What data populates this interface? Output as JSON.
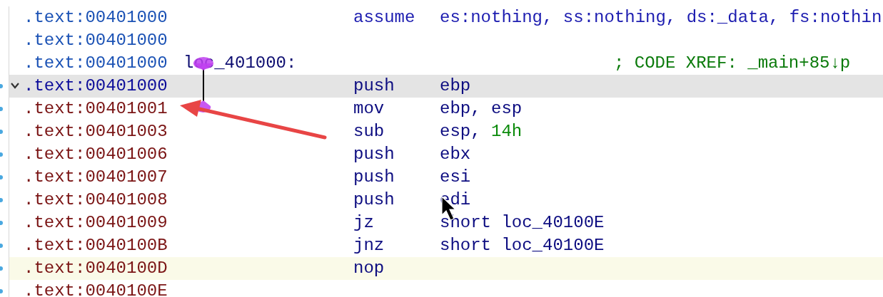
{
  "listing": {
    "rows": [
      {
        "kind": "directive",
        "address": ".text:00401000",
        "mnemonic": "assume",
        "operands": [
          {
            "kind": "plain",
            "text": "es:nothing, ss:nothing, ds:_data, fs:nothin"
          }
        ],
        "selected": false,
        "highlighted": false
      },
      {
        "kind": "directive",
        "address": ".text:00401000",
        "selected": false,
        "highlighted": false
      },
      {
        "kind": "label",
        "address": ".text:00401000",
        "label": "loc_401000:",
        "comment": "; CODE XREF: _main+85↓p",
        "selected": false,
        "highlighted": false
      },
      {
        "kind": "instruction",
        "address": ".text:00401000",
        "mnemonic": "push",
        "operands": [
          {
            "kind": "plain",
            "text": "ebp"
          }
        ],
        "selected": true,
        "highlighted": false
      },
      {
        "kind": "instruction",
        "address": ".text:00401001",
        "mnemonic": "mov",
        "operands": [
          {
            "kind": "plain",
            "text": "ebp, esp"
          }
        ],
        "selected": false,
        "highlighted": false
      },
      {
        "kind": "instruction",
        "address": ".text:00401003",
        "mnemonic": "sub",
        "operands": [
          {
            "kind": "plain",
            "text": "esp, "
          },
          {
            "kind": "number",
            "text": "14h"
          }
        ],
        "selected": false,
        "highlighted": false
      },
      {
        "kind": "instruction",
        "address": ".text:00401006",
        "mnemonic": "push",
        "operands": [
          {
            "kind": "plain",
            "text": "ebx"
          }
        ],
        "selected": false,
        "highlighted": false
      },
      {
        "kind": "instruction",
        "address": ".text:00401007",
        "mnemonic": "push",
        "operands": [
          {
            "kind": "plain",
            "text": "esi"
          }
        ],
        "selected": false,
        "highlighted": false
      },
      {
        "kind": "instruction",
        "address": ".text:00401008",
        "mnemonic": "push",
        "operands": [
          {
            "kind": "plain",
            "text": "edi"
          }
        ],
        "selected": false,
        "highlighted": false
      },
      {
        "kind": "instruction",
        "address": ".text:00401009",
        "mnemonic": "jz",
        "operands": [
          {
            "kind": "plain",
            "text": "short loc_40100E"
          }
        ],
        "selected": false,
        "highlighted": false
      },
      {
        "kind": "instruction",
        "address": ".text:0040100B",
        "mnemonic": "jnz",
        "operands": [
          {
            "kind": "plain",
            "text": "short loc_40100E"
          }
        ],
        "selected": false,
        "highlighted": false
      },
      {
        "kind": "instruction",
        "address": ".text:0040100D",
        "mnemonic": "nop",
        "selected": false,
        "highlighted": true
      },
      {
        "kind": "instruction",
        "address": ".text:0040100E",
        "selected": false,
        "highlighted": false
      }
    ]
  }
}
